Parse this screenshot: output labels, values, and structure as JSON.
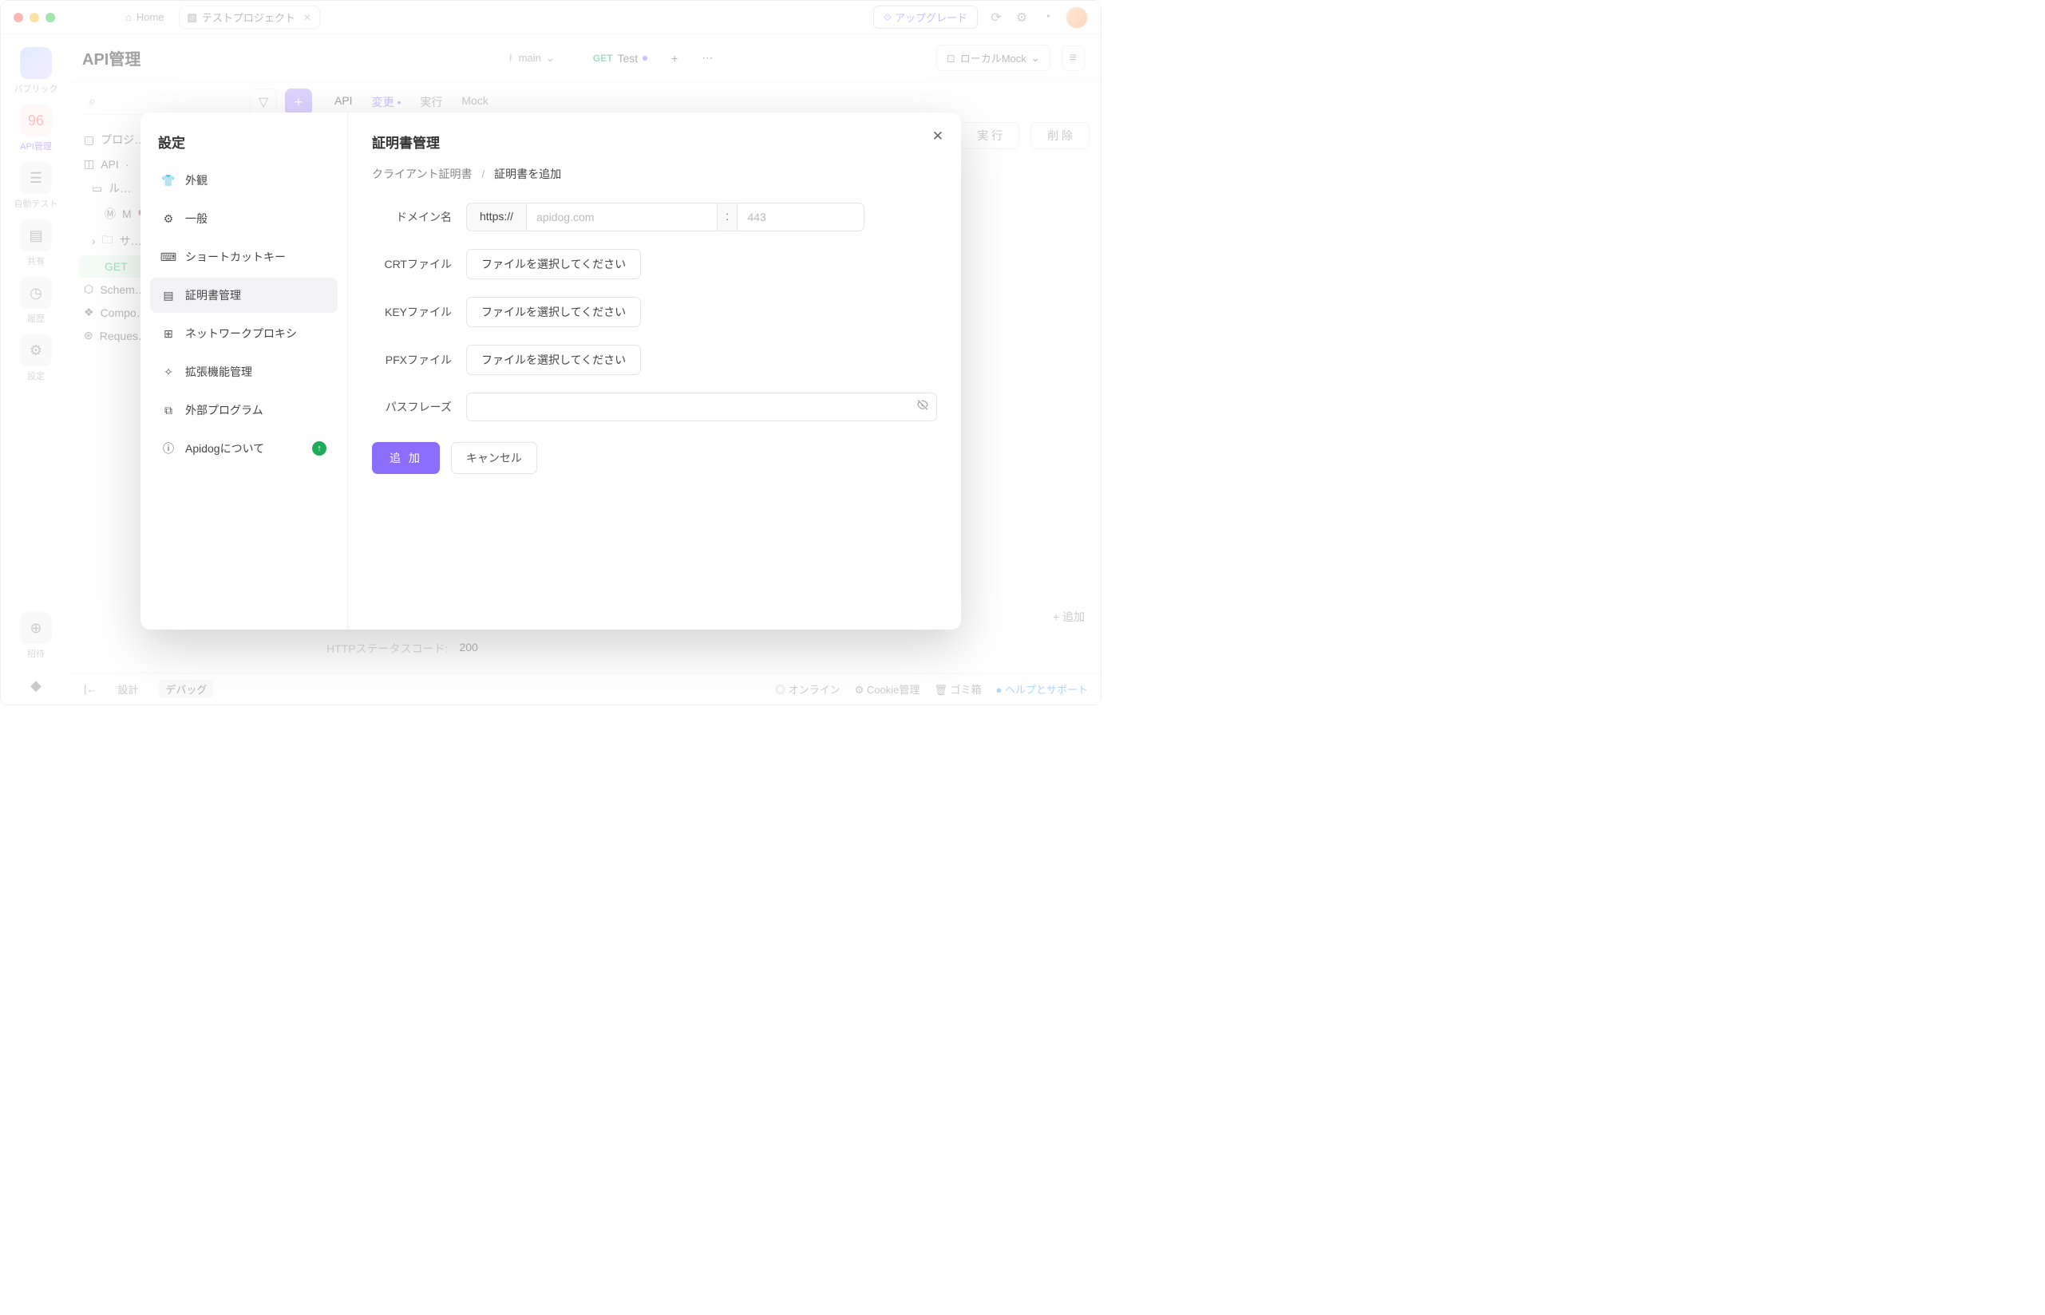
{
  "titlebar": {
    "home": "Home",
    "project": "テストプロジェクト",
    "upgrade": "アップグレード"
  },
  "rail": [
    {
      "label": "パブリック"
    },
    {
      "label": "API管理"
    },
    {
      "label": "自動テスト"
    },
    {
      "label": "共有"
    },
    {
      "label": "履歴"
    },
    {
      "label": "設定"
    },
    {
      "label": "招待"
    }
  ],
  "main": {
    "title": "API管理",
    "branch": "main",
    "editor_tab": {
      "method": "GET",
      "name": "Test"
    },
    "env": "ローカルMock",
    "subtabs": [
      "API",
      "変更",
      "実行",
      "Mock"
    ],
    "tree": {
      "project": "プロジ…",
      "api": "API",
      "root": "ル…",
      "m": "M",
      "folder": "サ…",
      "get": "GET",
      "schema": "Schem…",
      "compo": "Compo…",
      "request": "Reques…"
    },
    "actions": {
      "run": "実  行",
      "delete": "削  除"
    },
    "addrow": "追加",
    "http": {
      "label": "HTTPステータスコード:",
      "value": "200"
    }
  },
  "footer": {
    "design": "設計",
    "debug": "デバッグ",
    "online": "オンライン",
    "cookie": "Cookie管理",
    "trash": "ゴミ箱",
    "help": "ヘルプとサポート"
  },
  "modal": {
    "title": "設定",
    "nav": [
      {
        "id": "appearance",
        "label": "外観"
      },
      {
        "id": "general",
        "label": "一般"
      },
      {
        "id": "shortcut",
        "label": "ショートカットキー"
      },
      {
        "id": "cert",
        "label": "証明書管理"
      },
      {
        "id": "proxy",
        "label": "ネットワークプロキシ"
      },
      {
        "id": "plugin",
        "label": "拡張機能管理"
      },
      {
        "id": "external",
        "label": "外部プログラム"
      },
      {
        "id": "about",
        "label": "Apidogについて"
      }
    ],
    "panel": {
      "heading": "証明書管理",
      "crumb_parent": "クライアント証明書",
      "crumb_current": "証明書を追加",
      "labels": {
        "domain": "ドメイン名",
        "crt": "CRTファイル",
        "key": "KEYファイル",
        "pfx": "PFXファイル",
        "pass": "パスフレーズ"
      },
      "protocol": "https://",
      "host_placeholder": "apidog.com",
      "port_placeholder": "443",
      "file_button": "ファイルを選択してください",
      "add": "追 加",
      "cancel": "キャンセル",
      "colon": ":"
    }
  }
}
